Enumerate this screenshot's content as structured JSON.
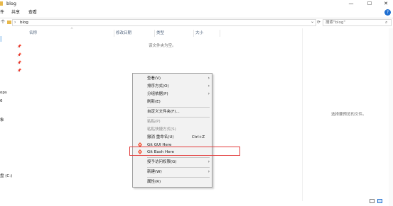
{
  "window": {
    "title": "blog",
    "minimize_glyph": "—",
    "maximize_glyph": "☐",
    "close_glyph": "✕"
  },
  "ribbon": {
    "tabs": [
      "件",
      "共享",
      "查看"
    ],
    "help_glyph": "?"
  },
  "address": {
    "nav_glyph": "个",
    "path": "blog",
    "dropdown_glyph": "⌄",
    "refresh_glyph": "⟳"
  },
  "search": {
    "placeholder": "搜索\"blog\"",
    "icon": "search-icon"
  },
  "nav_pane": {
    "items": [
      "ops",
      "6",
      "象",
      "盘 (C:)"
    ]
  },
  "columns": [
    "名称",
    "修改日期",
    "类型",
    "大小"
  ],
  "content": {
    "empty_message": "该文件夹为空。",
    "preview_message": "选择要预览的文件。"
  },
  "context_menu": {
    "items": [
      {
        "label": "查看(V)",
        "submenu": true
      },
      {
        "label": "排序方式(O)",
        "submenu": true
      },
      {
        "label": "分组依据(P)",
        "submenu": true
      },
      {
        "label": "刷新(E)"
      },
      {
        "label": "自定义文件夹(F)..."
      },
      {
        "label": "粘贴(P)",
        "disabled": true
      },
      {
        "label": "粘贴快捷方式(S)",
        "disabled": true
      },
      {
        "label": "撤消 重命名(U)",
        "shortcut": "Ctrl+Z"
      },
      {
        "label": "Git GUI Here",
        "icon": "git-gui-icon"
      },
      {
        "label": "Git Bash Here",
        "icon": "git-bash-icon"
      },
      {
        "label": "授予访问权限(G)",
        "submenu": true
      },
      {
        "label": "新建(W)",
        "submenu": true
      },
      {
        "label": "属性(R)"
      }
    ],
    "submenu_glyph": "›"
  },
  "colors": {
    "highlight": "#e23c3c",
    "menu_bg": "#f2f2f2",
    "folder": "#e8b84a"
  }
}
